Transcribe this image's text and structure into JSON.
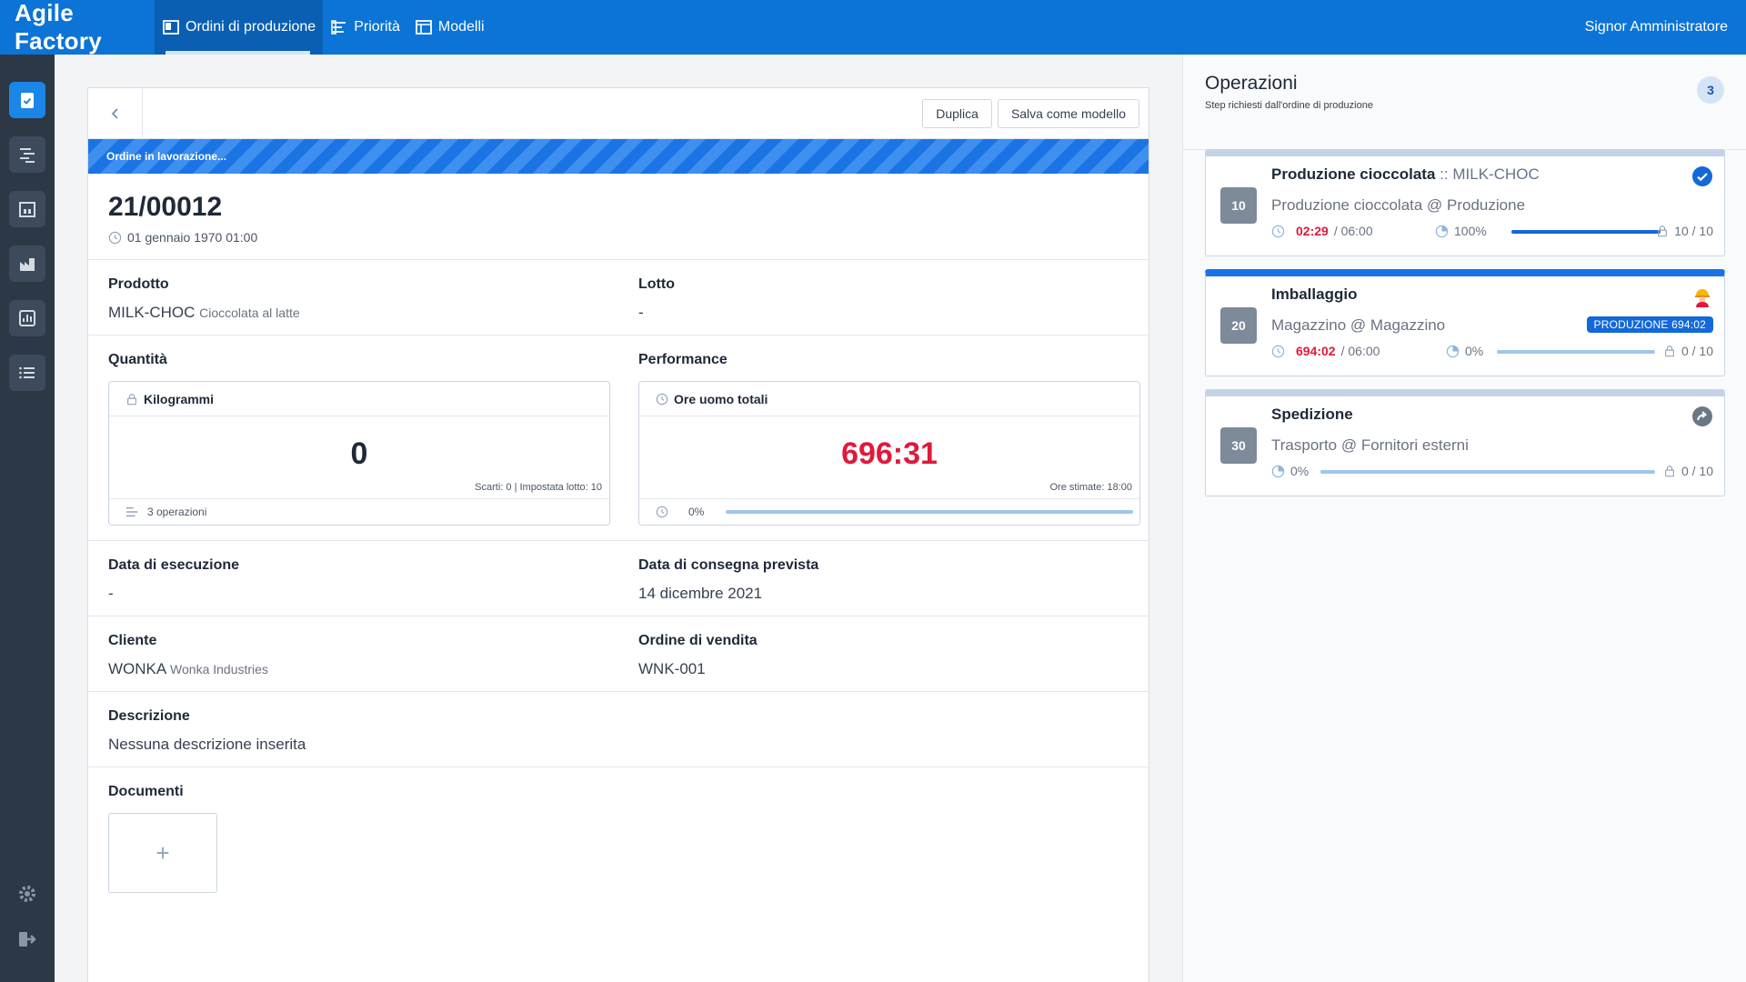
{
  "topbar": {
    "brand": "Agile Factory",
    "nav": [
      {
        "label": "Ordini di produzione"
      },
      {
        "label": "Priorità"
      },
      {
        "label": "Modelli"
      }
    ],
    "user": "Signor Amministratore"
  },
  "card": {
    "actions": {
      "duplicate": "Duplica",
      "save_template": "Salva come modello"
    },
    "status_banner": "Ordine in lavorazione...",
    "order_id": "21/00012",
    "order_date": "01 gennaio 1970 01:00"
  },
  "fields": {
    "product": {
      "label": "Prodotto",
      "code": "MILK-CHOC",
      "name": "Cioccolata al latte"
    },
    "lot": {
      "label": "Lotto",
      "value": "-"
    },
    "quantity": {
      "label": "Quantità",
      "unit": "Kilogrammi",
      "value": "0",
      "note": "Scarti: 0 | Impostata lotto: 10",
      "operations": "3 operazioni"
    },
    "performance": {
      "label": "Performance",
      "title": "Ore uomo totali",
      "value": "696:31",
      "note": "Ore stimate: 18:00",
      "progress_label": "0%",
      "progress": 0
    },
    "execution_date": {
      "label": "Data di esecuzione",
      "value": "-"
    },
    "delivery_date": {
      "label": "Data di consegna prevista",
      "value": "14 dicembre 2021"
    },
    "customer": {
      "label": "Cliente",
      "code": "WONKA",
      "name": "Wonka Industries"
    },
    "sales_order": {
      "label": "Ordine di vendita",
      "value": "WNK-001"
    },
    "description": {
      "label": "Descrizione",
      "value": "Nessuna descrizione inserita"
    },
    "documents": {
      "label": "Documenti",
      "add": "+"
    }
  },
  "operations_panel": {
    "title": "Operazioni",
    "subtitle": "Step richiesti dall'ordine di produzione",
    "count": "3",
    "items": [
      {
        "num": "10",
        "title": "Produzione cioccolata",
        "product_sep": "::",
        "product": "MILK-CHOC",
        "location": "Produzione cioccolata @ Produzione",
        "time_spent": "02:29",
        "time_est": "/ 06:00",
        "progress_label": "100%",
        "progress": 1.0,
        "qty": "10 / 10",
        "status_icon": "check-circle-icon"
      },
      {
        "num": "20",
        "title": "Imballaggio",
        "location": "Magazzino @ Magazzino",
        "time_spent": "694:02",
        "time_est": "/ 06:00",
        "progress_label": "0%",
        "progress": 0,
        "qty": "0 / 10",
        "badge": "PRODUZIONE  694:02",
        "status_icon": "worker-icon"
      },
      {
        "num": "30",
        "title": "Spedizione",
        "location": "Trasporto @ Fornitori esterni",
        "progress_label": "0%",
        "progress": 0,
        "qty": "0 / 10",
        "status_icon": "forward-arrow-icon"
      }
    ]
  },
  "colors": {
    "primary": "#0b74d6",
    "sidebar": "#2d3846",
    "alert": "#e0193a",
    "accent": "#1468d9"
  }
}
